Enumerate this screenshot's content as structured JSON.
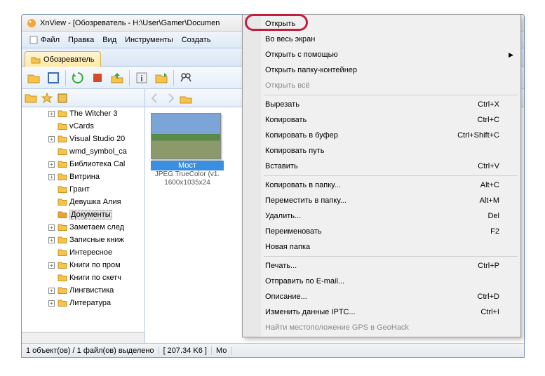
{
  "window": {
    "title": "XnView - [Обозреватель - H:\\User\\Gamer\\Documen"
  },
  "menubar": [
    "Файл",
    "Правка",
    "Вид",
    "Инструменты",
    "Создать"
  ],
  "tab": {
    "label": "Обозреватель"
  },
  "tree": {
    "items": [
      {
        "exp": "+",
        "label": "The Witcher 3"
      },
      {
        "exp": "",
        "label": "vCards"
      },
      {
        "exp": "+",
        "label": "Visual Studio 20"
      },
      {
        "exp": "",
        "label": "wmd_symbol_ca"
      },
      {
        "exp": "+",
        "label": "Библиотека Cal"
      },
      {
        "exp": "+",
        "label": "Витрина"
      },
      {
        "exp": "",
        "label": "Грант"
      },
      {
        "exp": "",
        "label": "Девушка Алия"
      },
      {
        "exp": "",
        "label": "Документы",
        "selected": true,
        "open": true
      },
      {
        "exp": "+",
        "label": "Заметаем след"
      },
      {
        "exp": "+",
        "label": "Записные книж"
      },
      {
        "exp": "",
        "label": "Интересное"
      },
      {
        "exp": "+",
        "label": "Книги по пром"
      },
      {
        "exp": "",
        "label": "Книги по скетч"
      },
      {
        "exp": "+",
        "label": "Лингвистика"
      },
      {
        "exp": "+",
        "label": "Литература"
      }
    ]
  },
  "thumb": {
    "name": "Мост",
    "meta1": "JPEG TrueColor (v1.",
    "meta2": "1600x1035x24"
  },
  "statusbar": {
    "seg1": "1 объект(ов) / 1 файл(ов) выделено",
    "seg2": "[ 207.34 K6 ]",
    "seg3": "Мо"
  },
  "context": [
    {
      "t": "item",
      "label": "Открыть",
      "highlighted": true
    },
    {
      "t": "item",
      "label": "Во весь экран"
    },
    {
      "t": "item",
      "label": "Открыть с помощью",
      "submenu": true
    },
    {
      "t": "item",
      "label": "Открыть папку-контейнер"
    },
    {
      "t": "item",
      "label": "Открыть всё",
      "disabled": true
    },
    {
      "t": "sep"
    },
    {
      "t": "item",
      "label": "Вырезать",
      "shortcut": "Ctrl+X"
    },
    {
      "t": "item",
      "label": "Копировать",
      "shortcut": "Ctrl+C"
    },
    {
      "t": "item",
      "label": "Копировать в буфер",
      "shortcut": "Ctrl+Shift+C"
    },
    {
      "t": "item",
      "label": "Копировать путь"
    },
    {
      "t": "item",
      "label": "Вставить",
      "shortcut": "Ctrl+V"
    },
    {
      "t": "sep"
    },
    {
      "t": "item",
      "label": "Копировать в папку...",
      "shortcut": "Alt+C"
    },
    {
      "t": "item",
      "label": "Переместить в папку...",
      "shortcut": "Alt+M"
    },
    {
      "t": "item",
      "label": "Удалить...",
      "shortcut": "Del"
    },
    {
      "t": "item",
      "label": "Переименовать",
      "shortcut": "F2"
    },
    {
      "t": "item",
      "label": "Новая папка"
    },
    {
      "t": "sep"
    },
    {
      "t": "item",
      "label": "Печать...",
      "shortcut": "Ctrl+P"
    },
    {
      "t": "item",
      "label": "Отправить по E-mail..."
    },
    {
      "t": "item",
      "label": "Описание...",
      "shortcut": "Ctrl+D"
    },
    {
      "t": "item",
      "label": "Изменить данные IPTC...",
      "shortcut": "Ctrl+I"
    },
    {
      "t": "item",
      "label": "Найти местоположение GPS в GeoHack",
      "disabled": true
    }
  ],
  "icons": {
    "app": "xnview-icon",
    "folder_y": "#f6c44a",
    "folder_o": "#f0a030"
  }
}
